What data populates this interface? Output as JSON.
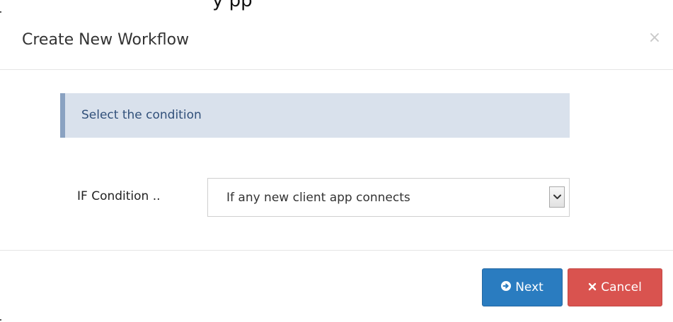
{
  "top_cut_text": "y        pp",
  "dialog": {
    "title": "Create New Workflow",
    "close_symbol": "×"
  },
  "alert": {
    "text": "Select the condition"
  },
  "condition": {
    "label": "IF Condition ..",
    "selected_value": "If any new client app connects"
  },
  "buttons": {
    "next_label": "Next",
    "cancel_label": "Cancel"
  },
  "icons": {
    "next": "arrow-right-icon",
    "cancel": "x-icon",
    "dropdown": "chevron-down-icon"
  },
  "colors": {
    "primary": "#2a7cc0",
    "danger": "#d9534f",
    "alert_bg": "#d9e1ec",
    "alert_border": "#8aa2c1",
    "alert_text": "#31507a"
  }
}
